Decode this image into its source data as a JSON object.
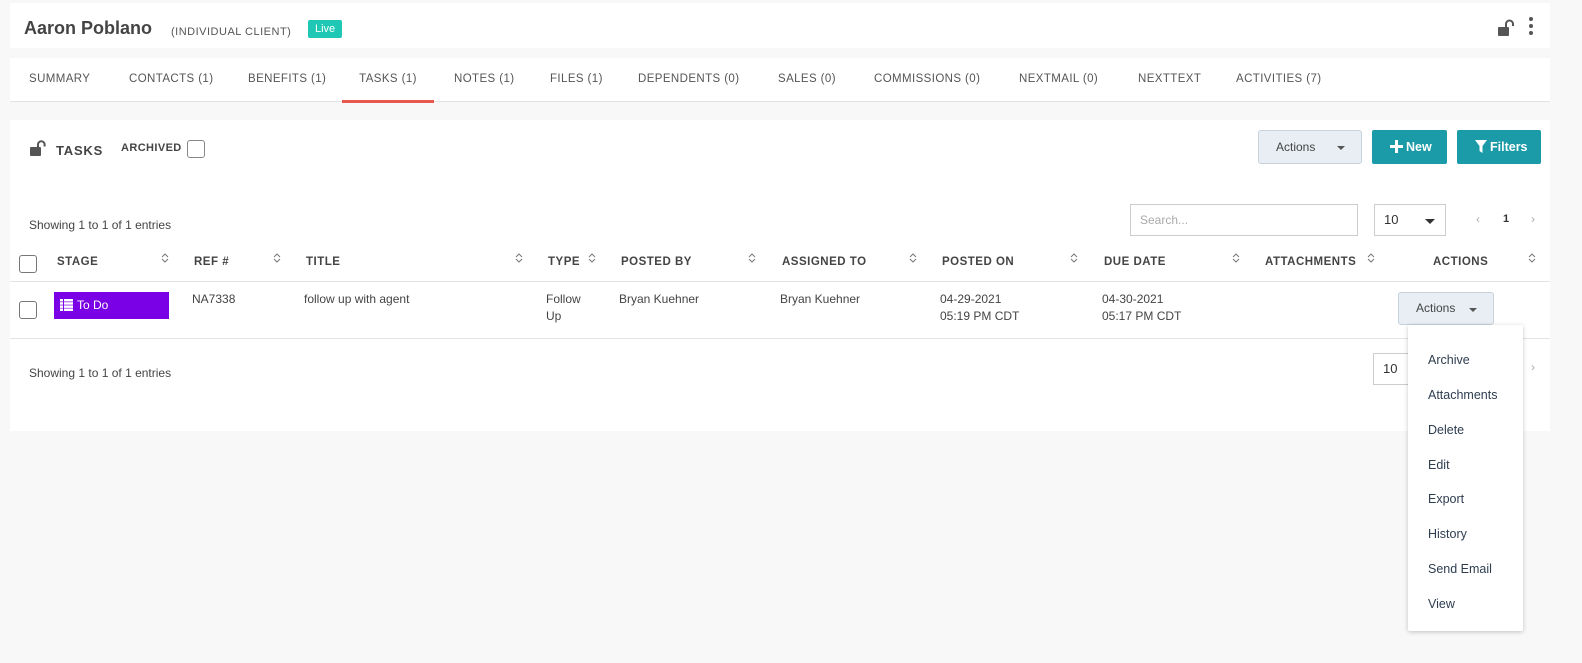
{
  "header": {
    "client_name": "Aaron Poblano",
    "client_type": "(INDIVIDUAL CLIENT)",
    "status_badge": "Live"
  },
  "tabs": [
    {
      "label": "SUMMARY",
      "active": false
    },
    {
      "label": "CONTACTS (1)",
      "active": false
    },
    {
      "label": "BENEFITS (1)",
      "active": false
    },
    {
      "label": "TASKS (1)",
      "active": true
    },
    {
      "label": "NOTES (1)",
      "active": false
    },
    {
      "label": "FILES (1)",
      "active": false
    },
    {
      "label": "DEPENDENTS (0)",
      "active": false
    },
    {
      "label": "SALES (0)",
      "active": false
    },
    {
      "label": "COMMISSIONS (0)",
      "active": false
    },
    {
      "label": "NEXTMAIL (0)",
      "active": false
    },
    {
      "label": "NEXTTEXT",
      "active": false
    },
    {
      "label": "ACTIVITIES (7)",
      "active": false
    }
  ],
  "panel": {
    "title": "TASKS",
    "archived_label": "ARCHIVED",
    "archived_checked": false,
    "actions_label": "Actions",
    "new_label": "New",
    "filters_label": "Filters",
    "showing_top": "Showing 1 to 1 of 1 entries",
    "showing_bottom": "Showing 1 to 1 of 1 entries",
    "search_placeholder": "Search...",
    "page_size": "10",
    "page_size_bottom": "10",
    "pager": {
      "prev": "‹",
      "current": "1",
      "next": "›"
    }
  },
  "table": {
    "headers": {
      "stage": "STAGE",
      "ref": "REF #",
      "title": "TITLE",
      "type": "TYPE",
      "posted_by": "POSTED BY",
      "assigned_to": "ASSIGNED TO",
      "posted_on": "POSTED ON",
      "due_date": "DUE DATE",
      "attachments": "ATTACHMENTS",
      "actions": "ACTIONS"
    },
    "rows": [
      {
        "stage": "To Do",
        "ref": "NA7338",
        "title": "follow up with agent",
        "type_line1": "Follow",
        "type_line2": "Up",
        "posted_by": "Bryan Kuehner",
        "assigned_to": "Bryan Kuehner",
        "posted_on_date": "04-29-2021",
        "posted_on_time": "05:19 PM CDT",
        "due_date": "04-30-2021",
        "due_time": "05:17 PM CDT",
        "attachments": "",
        "actions_label": "Actions"
      }
    ]
  },
  "row_menu": [
    "Archive",
    "Attachments",
    "Delete",
    "Edit",
    "Export",
    "History",
    "Send Email",
    "View"
  ],
  "colors": {
    "accent": "#1b9aa7",
    "live": "#1ec8b4",
    "stage_todo": "#7a00e6",
    "active_tab": "#e8584f"
  },
  "icons": {
    "header_lock": "unlock-icon",
    "header_menu": "kebab-menu-icon",
    "panel_lock": "unlock-icon",
    "new": "plus-icon",
    "filters": "filter-icon",
    "stage": "list-icon",
    "sort": "sort-icon"
  }
}
